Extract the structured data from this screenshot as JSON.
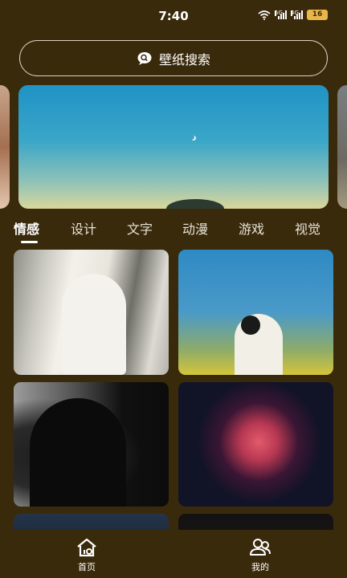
{
  "status_bar": {
    "time": "7:40",
    "signal_1_label": "5G",
    "signal_2_label": "4G",
    "battery": "16"
  },
  "search": {
    "label": "壁纸搜索",
    "icon": "search-chat-icon"
  },
  "banner": {
    "icons": [
      "moon",
      "tree"
    ]
  },
  "tabs": [
    {
      "label": "情感",
      "active": true
    },
    {
      "label": "设计",
      "active": false
    },
    {
      "label": "文字",
      "active": false
    },
    {
      "label": "动漫",
      "active": false
    },
    {
      "label": "游戏",
      "active": false
    },
    {
      "label": "视觉",
      "active": false
    }
  ],
  "wallpapers": [
    {
      "subject": "white-dress"
    },
    {
      "subject": "girl-in-flowers"
    },
    {
      "subject": "silhouette"
    },
    {
      "subject": "fireworks"
    },
    {
      "subject": "fireworks-partial"
    },
    {
      "subject": "fireworks-partial"
    }
  ],
  "bottom_nav": {
    "home_label": "首页",
    "me_label": "我的"
  },
  "colors": {
    "background": "#3a2a0c",
    "battery": "#e8b64a",
    "text": "#ffffff"
  }
}
